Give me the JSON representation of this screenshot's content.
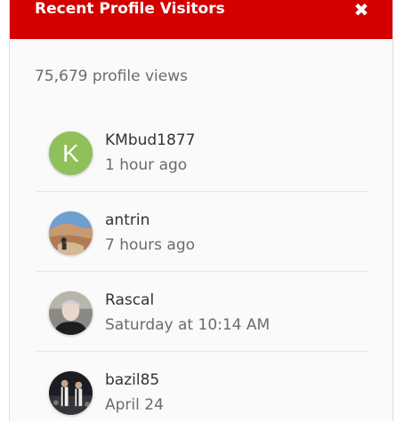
{
  "header": {
    "title": "Recent Profile Visitors",
    "close_icon": "close-icon"
  },
  "profile_views": "75,679 profile views",
  "colors": {
    "header_bg": "#d40000",
    "avatar_k": "#8fc05a"
  },
  "visitors": [
    {
      "name": "KMbud1877",
      "time": "1 hour ago",
      "avatar_letter": "K",
      "avatar": "letter-avatar"
    },
    {
      "name": "antrin",
      "time": "7 hours ago",
      "avatar": "photo-avatar"
    },
    {
      "name": "Rascal",
      "time": "Saturday at 10:14 AM",
      "avatar": "photo-avatar"
    },
    {
      "name": "bazil85",
      "time": "April 24",
      "avatar": "photo-avatar"
    }
  ]
}
